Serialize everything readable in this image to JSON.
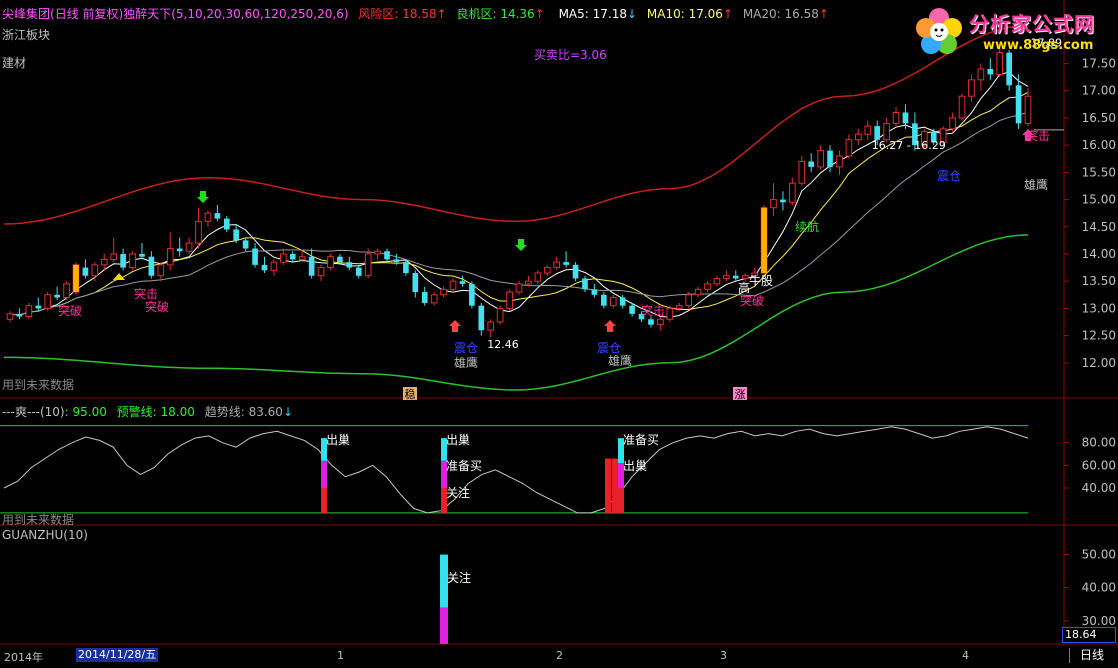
{
  "header": {
    "stock_name": "尖峰集团",
    "period": "(日线 前复权)",
    "indicator_name": "独醉天下(5,10,20,30,60,120,250,20,6)",
    "risk_label": "风险区: ",
    "risk_value": "18.58",
    "good_label": "良机区: ",
    "good_value": "14.36",
    "ma5_label": "MA5: ",
    "ma5_value": "17.18",
    "ma10_label": "MA10: ",
    "ma10_value": "17.06",
    "ma20_label": "MA20: ",
    "ma20_value": "16.58",
    "sector1": "浙江板块",
    "sector2": "建材",
    "buy_sell_ratio": "买卖比=3.06",
    "future_data_note": "用到未来数据"
  },
  "logo": {
    "text": "分析家公式网",
    "url": "www.88gs.com",
    "colors": {
      "pink": "#ff3399",
      "yellow": "#ffe000",
      "green": "#33cc33"
    }
  },
  "main_annotations": {
    "high_label": "17.89",
    "range_label": "16.27 - 16.29",
    "low_label": "12.46",
    "labels": [
      {
        "text": "突破",
        "color": "#ff3399"
      },
      {
        "text": "突击",
        "color": "#ff3399"
      },
      {
        "text": "突破",
        "color": "#ff3399"
      },
      {
        "text": "震仓",
        "color": "#3344ff"
      },
      {
        "text": "雄鹰",
        "color": "#c0c0c0"
      },
      {
        "text": "震仓",
        "color": "#3344ff"
      },
      {
        "text": "雄鹰",
        "color": "#c0c0c0"
      },
      {
        "text": "突击",
        "color": "#ff3399"
      },
      {
        "text": "续航",
        "color": "#33dd33"
      },
      {
        "text": "牛股",
        "color": "#ffffff"
      },
      {
        "text": "高",
        "color": "#ffffff"
      },
      {
        "text": "突破",
        "color": "#ff3399"
      },
      {
        "text": "震仓",
        "color": "#3344ff"
      },
      {
        "text": "雄鹰",
        "color": "#c0c0c0"
      },
      {
        "text": "突击",
        "color": "#ff3399"
      }
    ],
    "bottom_tag_left": "稳",
    "bottom_tag_right": "涨"
  },
  "sub1": {
    "title": "---爽---(10)",
    "v1_label": ": ",
    "v1_value": "95.00",
    "warn_label": "预警线: ",
    "warn_value": "18.00",
    "trend_label": "趋势线: ",
    "trend_value": "83.60",
    "future_note": "用到未来数据",
    "labels": [
      "出巢",
      "准备买",
      "关注",
      "出巢",
      "准备买",
      "出巢",
      "准备买"
    ]
  },
  "sub2": {
    "title": "GUANZHU(10)",
    "label": "关注"
  },
  "timeline": {
    "year": "2014年",
    "date": "2014/11/28/五",
    "months": [
      "1",
      "2",
      "3",
      "4"
    ]
  },
  "footer": {
    "period_button": "日线",
    "price_box": "18.64"
  },
  "chart_data": [
    {
      "type": "candlestick",
      "title": "尖峰集团 (日线 前复权)",
      "y_ticks": [
        12.0,
        12.5,
        13.0,
        13.5,
        14.0,
        14.5,
        15.0,
        15.5,
        16.0,
        16.5,
        17.0,
        17.5
      ],
      "ylim": [
        11.5,
        18.3
      ],
      "candles": [
        [
          12.8,
          12.95,
          12.75,
          12.9
        ],
        [
          12.9,
          13.0,
          12.8,
          12.85
        ],
        [
          12.85,
          13.1,
          12.8,
          13.05
        ],
        [
          13.05,
          13.2,
          12.95,
          13.0
        ],
        [
          13.0,
          13.3,
          12.95,
          13.25
        ],
        [
          13.25,
          13.4,
          13.15,
          13.2
        ],
        [
          13.2,
          13.5,
          13.15,
          13.45
        ],
        [
          13.3,
          13.85,
          13.25,
          13.8
        ],
        [
          13.75,
          13.9,
          13.55,
          13.6
        ],
        [
          13.6,
          13.85,
          13.5,
          13.8
        ],
        [
          13.8,
          14.0,
          13.7,
          13.9
        ],
        [
          13.9,
          14.3,
          13.85,
          14.0
        ],
        [
          14.0,
          14.1,
          13.7,
          13.75
        ],
        [
          13.75,
          14.05,
          13.7,
          14.0
        ],
        [
          14.0,
          14.2,
          13.9,
          13.95
        ],
        [
          13.95,
          14.05,
          13.55,
          13.6
        ],
        [
          13.6,
          13.85,
          13.5,
          13.8
        ],
        [
          13.8,
          14.4,
          13.7,
          14.1
        ],
        [
          14.1,
          14.3,
          13.95,
          14.05
        ],
        [
          14.05,
          14.3,
          14.0,
          14.2
        ],
        [
          14.2,
          14.85,
          14.1,
          14.6
        ],
        [
          14.6,
          14.8,
          14.5,
          14.75
        ],
        [
          14.75,
          14.9,
          14.6,
          14.65
        ],
        [
          14.65,
          14.7,
          14.4,
          14.45
        ],
        [
          14.45,
          14.55,
          14.2,
          14.25
        ],
        [
          14.25,
          14.3,
          14.05,
          14.1
        ],
        [
          14.1,
          14.2,
          13.75,
          13.8
        ],
        [
          13.8,
          13.95,
          13.65,
          13.7
        ],
        [
          13.7,
          13.9,
          13.6,
          13.85
        ],
        [
          13.85,
          14.1,
          13.8,
          14.0
        ],
        [
          14.0,
          14.05,
          13.85,
          13.9
        ],
        [
          13.9,
          14.05,
          13.85,
          13.95
        ],
        [
          13.95,
          14.1,
          13.55,
          13.6
        ],
        [
          13.6,
          13.8,
          13.5,
          13.75
        ],
        [
          13.75,
          14.0,
          13.7,
          13.95
        ],
        [
          13.95,
          14.0,
          13.8,
          13.85
        ],
        [
          13.85,
          13.95,
          13.7,
          13.75
        ],
        [
          13.75,
          13.8,
          13.55,
          13.6
        ],
        [
          13.6,
          14.1,
          13.55,
          14.0
        ],
        [
          14.0,
          14.1,
          13.9,
          14.05
        ],
        [
          14.05,
          14.1,
          13.85,
          13.9
        ],
        [
          13.9,
          14.0,
          13.8,
          13.85
        ],
        [
          13.85,
          13.9,
          13.6,
          13.65
        ],
        [
          13.65,
          13.7,
          13.2,
          13.3
        ],
        [
          13.3,
          13.4,
          13.05,
          13.1
        ],
        [
          13.1,
          13.3,
          13.05,
          13.25
        ],
        [
          13.25,
          13.4,
          13.2,
          13.35
        ],
        [
          13.35,
          13.55,
          13.3,
          13.5
        ],
        [
          13.5,
          13.6,
          13.4,
          13.45
        ],
        [
          13.45,
          13.5,
          13.0,
          13.05
        ],
        [
          13.05,
          13.1,
          12.5,
          12.6
        ],
        [
          12.6,
          12.8,
          12.46,
          12.75
        ],
        [
          12.75,
          13.05,
          12.7,
          13.0
        ],
        [
          13.0,
          13.35,
          12.95,
          13.3
        ],
        [
          13.3,
          13.5,
          13.25,
          13.45
        ],
        [
          13.45,
          13.6,
          13.4,
          13.5
        ],
        [
          13.5,
          13.7,
          13.45,
          13.65
        ],
        [
          13.65,
          13.8,
          13.6,
          13.75
        ],
        [
          13.75,
          13.95,
          13.7,
          13.85
        ],
        [
          13.85,
          14.05,
          13.75,
          13.8
        ],
        [
          13.8,
          13.85,
          13.5,
          13.55
        ],
        [
          13.55,
          13.6,
          13.3,
          13.35
        ],
        [
          13.35,
          13.45,
          13.2,
          13.25
        ],
        [
          13.25,
          13.3,
          13.0,
          13.05
        ],
        [
          13.05,
          13.25,
          13.0,
          13.2
        ],
        [
          13.2,
          13.25,
          13.0,
          13.05
        ],
        [
          13.05,
          13.1,
          12.85,
          12.9
        ],
        [
          12.9,
          12.95,
          12.75,
          12.8
        ],
        [
          12.8,
          12.85,
          12.65,
          12.7
        ],
        [
          12.7,
          12.85,
          12.6,
          12.8
        ],
        [
          12.8,
          13.05,
          12.75,
          13.0
        ],
        [
          13.0,
          13.1,
          12.95,
          13.05
        ],
        [
          13.05,
          13.3,
          13.0,
          13.25
        ],
        [
          13.25,
          13.4,
          13.2,
          13.35
        ],
        [
          13.35,
          13.5,
          13.3,
          13.45
        ],
        [
          13.45,
          13.6,
          13.4,
          13.55
        ],
        [
          13.55,
          13.7,
          13.5,
          13.6
        ],
        [
          13.6,
          13.7,
          13.5,
          13.55
        ],
        [
          13.55,
          13.65,
          13.5,
          13.6
        ],
        [
          13.6,
          13.75,
          13.55,
          13.65
        ],
        [
          13.65,
          14.9,
          13.6,
          14.85
        ],
        [
          14.85,
          15.3,
          14.7,
          15.0
        ],
        [
          15.0,
          15.15,
          14.8,
          14.95
        ],
        [
          14.95,
          15.4,
          14.9,
          15.3
        ],
        [
          15.3,
          15.8,
          15.25,
          15.7
        ],
        [
          15.7,
          15.85,
          15.5,
          15.6
        ],
        [
          15.6,
          16.0,
          15.55,
          15.9
        ],
        [
          15.9,
          16.0,
          15.5,
          15.6
        ],
        [
          15.6,
          15.9,
          15.45,
          15.8
        ],
        [
          15.8,
          16.2,
          15.75,
          16.1
        ],
        [
          16.1,
          16.3,
          16.0,
          16.2
        ],
        [
          16.2,
          16.45,
          16.1,
          16.35
        ],
        [
          16.35,
          16.45,
          16.0,
          16.1
        ],
        [
          16.1,
          16.5,
          16.05,
          16.4
        ],
        [
          16.4,
          16.7,
          16.35,
          16.6
        ],
        [
          16.6,
          16.75,
          16.3,
          16.4
        ],
        [
          16.4,
          16.6,
          15.9,
          16.0
        ],
        [
          16.0,
          16.3,
          15.95,
          16.25
        ],
        [
          16.25,
          16.3,
          16.0,
          16.05
        ],
        [
          16.05,
          16.35,
          16.0,
          16.3
        ],
        [
          16.3,
          16.6,
          16.25,
          16.5
        ],
        [
          16.5,
          16.95,
          16.45,
          16.9
        ],
        [
          16.9,
          17.3,
          16.8,
          17.2
        ],
        [
          17.2,
          17.5,
          17.0,
          17.4
        ],
        [
          17.4,
          17.6,
          17.2,
          17.3
        ],
        [
          17.3,
          17.89,
          17.25,
          17.7
        ],
        [
          17.7,
          17.75,
          17.0,
          17.1
        ],
        [
          17.1,
          17.3,
          16.3,
          16.4
        ],
        [
          16.4,
          17.05,
          16.35,
          16.9
        ]
      ],
      "bands": {
        "upper_red": [
          14.55,
          15.4,
          15.0,
          14.6,
          15.2,
          16.9,
          18.2
        ],
        "lower_green": [
          12.1,
          11.9,
          11.8,
          11.5,
          12.0,
          13.3,
          14.35
        ]
      },
      "bands_t": [
        0,
        0.2,
        0.35,
        0.5,
        0.65,
        0.82,
        1.0
      ]
    },
    {
      "type": "line",
      "title": "---爽---(10)",
      "y_ticks": [
        40.0,
        60.0,
        80.0
      ],
      "ylim": [
        10,
        100
      ],
      "reference_lines": [
        95.0,
        18.0
      ],
      "values": [
        40,
        46,
        58,
        66,
        74,
        80,
        85,
        82,
        76,
        60,
        52,
        58,
        70,
        78,
        84,
        86,
        80,
        76,
        84,
        88,
        90,
        86,
        82,
        74,
        60,
        50,
        54,
        60,
        50,
        35,
        22,
        18,
        20,
        30,
        44,
        52,
        56,
        50,
        44,
        36,
        30,
        24,
        18,
        18,
        22,
        34,
        50,
        62,
        74,
        80,
        84,
        86,
        84,
        88,
        90,
        86,
        88,
        86,
        90,
        92,
        88,
        86,
        88,
        90,
        92,
        94,
        92,
        88,
        84,
        86,
        90,
        92,
        94,
        92,
        88,
        84
      ]
    },
    {
      "type": "bar",
      "title": "GUANZHU(10)",
      "y_ticks": [
        30.0,
        40.0,
        50.0
      ],
      "ylim": [
        23,
        55
      ],
      "bars": [
        {
          "cyan": [
            34,
            50
          ],
          "magenta": [
            23,
            34
          ]
        }
      ]
    }
  ]
}
